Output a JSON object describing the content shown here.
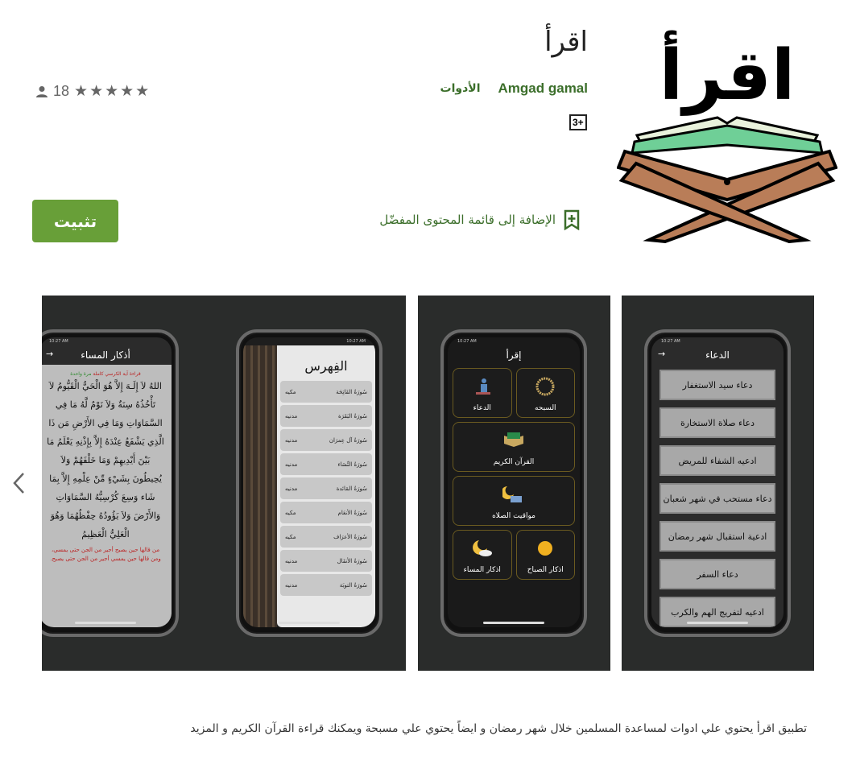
{
  "app": {
    "title": "اقرأ",
    "developer": "Amgad gamal",
    "category": "الأدوات",
    "content_rating": "3+",
    "rating_count": "18",
    "stars": "★★★★★",
    "install_label": "تثبيت",
    "wishlist_label": "الإضافة إلى قائمة المحتوى المفضّل",
    "description": "تطبيق اقرأ يحتوي علي ادوات لمساعدة المسلمين خلال شهر رمضان و ايضاً يحتوي علي مسبحة ويمكنك قراءة القرآن الكريم و المزيد",
    "icon_text": "اقرأ",
    "accent_color": "#689f38"
  },
  "screenshots": {
    "shot1": {
      "title": "الدعاء",
      "time": "10:27 AM",
      "items": [
        "دعاء سيد الاستغفار",
        "دعاء صلاة الاستخارة",
        "ادعيه الشفاء للمريض",
        "دعاء مستحب في شهر شعبان",
        "ادعية استقبال شهر رمضان",
        "دعاء السفر",
        "ادعيه لتفريج الهم والكرب"
      ]
    },
    "shot2": {
      "title": "إقرأ",
      "time": "10:27 AM",
      "tiles": [
        "الدعاء",
        "السبحه",
        "القرآن الكريم",
        "مواقيت الصلاه",
        "اذكار المساء",
        "اذكار الصباح"
      ]
    },
    "shot3": {
      "title": "الفِهرس",
      "time": "10:27 AM",
      "suras": [
        {
          "name": "سُورَةُ الفَاتِحَة",
          "type": "مكيه"
        },
        {
          "name": "سُورَةُ البَقَرَة",
          "type": "مدنيه"
        },
        {
          "name": "سُورَةُ آل عِمرَان",
          "type": "مدنيه"
        },
        {
          "name": "سُورَةُ النِّسَاء",
          "type": "مدنيه"
        },
        {
          "name": "سُورَةُ المَائدة",
          "type": "مدنيه"
        },
        {
          "name": "سُورَةُ الأنعَام",
          "type": "مكيه"
        },
        {
          "name": "سُورَةُ الأعرَاف",
          "type": "مكيه"
        },
        {
          "name": "سُورَةُ الأنفَال",
          "type": "مدنيه"
        },
        {
          "name": "سُورَةُ التوبَة",
          "type": "مدنيه"
        }
      ]
    },
    "shot4": {
      "title": "أذكار المساء",
      "time": "10:27 AM",
      "header": "قراءة آية الكرسي كاملة",
      "header_count": "مرة واحدة",
      "verse": "اللهُ لاَ إِلَـهَ إِلاَّ هُوَ الْحَيُّ الْقَيُّومُ لاَ تَأْخُذُهُ سِنَةٌ وَلاَ نَوْمٌ لَّهُ مَا فِي السَّمَاوَاتِ وَمَا فِي الأَرْضِ مَن ذَا الَّذِي يَشْفَعُ عِنْدَهُ إِلاَّ بِإِذْنِهِ يَعْلَمُ مَا بَيْنَ أَيْدِيهِمْ وَمَا خَلْفَهُمْ وَلاَ يُحِيطُونَ بِشَيْءٍ مِّنْ عِلْمِهِ إِلاَّ بِمَا شَاء وَسِعَ كُرْسِيُّهُ السَّمَاوَاتِ وَالأَرْضَ وَلاَ يَؤُودُهُ حِفْظُهُمَا وَهُوَ الْعَلِيُّ الْعَظِيمُ",
      "note": "من قالها حين يصبح أجير من الجن حتى يمسي، ومن قالها حين يمسي أجير من الجن حتى يصبح."
    }
  }
}
